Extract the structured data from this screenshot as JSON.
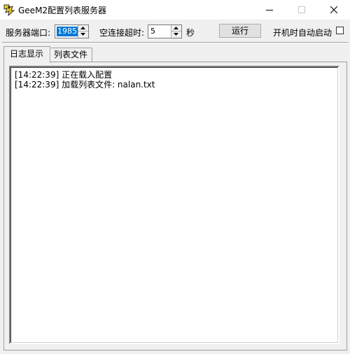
{
  "window": {
    "title": "GeeM2配置列表服务器",
    "icon": "app-icon",
    "controls": [
      "minimize-icon",
      "maximize-icon",
      "close-icon"
    ]
  },
  "toolbar": {
    "port_label": "服务器端口:",
    "port_value": "1985",
    "timeout_label": "空连接超时:",
    "timeout_value": "5",
    "timeout_unit": "秒",
    "run_button": "运行",
    "autostart_label": "开机时自动启动",
    "autostart_checked": false
  },
  "tabs": [
    {
      "label": "日志显示",
      "active": true
    },
    {
      "label": "列表文件",
      "active": false
    }
  ],
  "log": {
    "lines": [
      "[14:22:39] 正在载入配置",
      "[14:22:39] 加载列表文件: nalan.txt"
    ]
  },
  "colors": {
    "selection": "#0078d7",
    "window_bg": "#f0f0f0",
    "titlebar_bg": "#ffffff"
  }
}
